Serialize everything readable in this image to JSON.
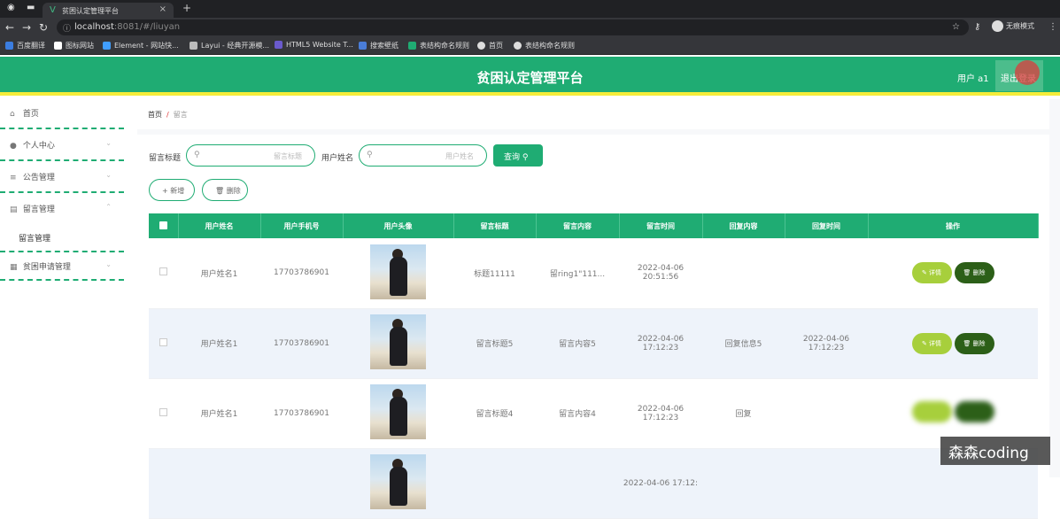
{
  "browser": {
    "tab_title": "贫困认定管理平台",
    "url_host": "localhost",
    "url_rest": ":8081/#/liuyan",
    "profile": "无痕模式",
    "bookmarks": [
      "百度翻译",
      "图标网站",
      "Element - 网站快...",
      "Layui - 经典开源模...",
      "HTML5 Website T...",
      "搜索壁纸",
      "表结构命名规则",
      "首页",
      "表结构命名规则"
    ]
  },
  "header": {
    "title": "贫困认定管理平台",
    "user": "用户 a1",
    "logout": "退出登录"
  },
  "sidebar": {
    "items": [
      {
        "label": "首页",
        "icon": "home-icon"
      },
      {
        "label": "个人中心",
        "icon": "person-icon"
      },
      {
        "label": "公告管理",
        "icon": "list-icon"
      },
      {
        "label": "留言管理",
        "icon": "message-icon"
      },
      {
        "label": "贫困申请管理",
        "icon": "grid-icon"
      }
    ],
    "sub_item": "留言管理"
  },
  "breadcrumb": {
    "home": "首页",
    "current": "留言"
  },
  "search": {
    "title_label": "留言标题",
    "title_placeholder": "留言标题",
    "name_label": "用户姓名",
    "name_placeholder": "用户姓名",
    "query": "查询"
  },
  "actions": {
    "add": "+ 新增",
    "delete": "删除"
  },
  "table": {
    "headers": [
      "用户姓名",
      "用户手机号",
      "用户头像",
      "留言标题",
      "留言内容",
      "留言时间",
      "回复内容",
      "回复时间",
      "操作"
    ],
    "rows": [
      {
        "name": "用户姓名1",
        "phone": "17703786901",
        "title": "标题11111",
        "content": "留ring1\"111...",
        "time": "2022-04-06 20:51:56",
        "reply": "",
        "reply_time": ""
      },
      {
        "name": "用户姓名1",
        "phone": "17703786901",
        "title": "留言标题5",
        "content": "留言内容5",
        "time": "2022-04-06 17:12:23",
        "reply": "回复信息5",
        "reply_time": "2022-04-06 17:12:23"
      },
      {
        "name": "用户姓名1",
        "phone": "17703786901",
        "title": "留言标题4",
        "content": "留言内容4",
        "time": "2022-04-06 17:12:23",
        "reply": "回复",
        "reply_time": ""
      },
      {
        "name": "",
        "phone": "",
        "title": "",
        "content": "",
        "time": "2022-04-06 17:12:",
        "reply": "",
        "reply_time": ""
      }
    ],
    "detail": "详情",
    "delete": "删除"
  },
  "watermark": "森森coding"
}
